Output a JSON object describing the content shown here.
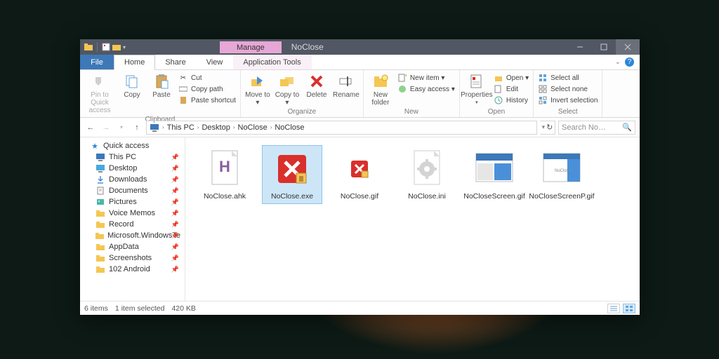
{
  "titlebar": {
    "manage": "Manage",
    "title": "NoClose"
  },
  "tabs": {
    "file": "File",
    "home": "Home",
    "share": "Share",
    "view": "View",
    "app_tools": "Application Tools"
  },
  "ribbon": {
    "clipboard": {
      "label": "Clipboard",
      "pin": "Pin to Quick access",
      "copy": "Copy",
      "paste": "Paste",
      "cut": "Cut",
      "copy_path": "Copy path",
      "paste_shortcut": "Paste shortcut"
    },
    "organize": {
      "label": "Organize",
      "move": "Move to ▾",
      "copy": "Copy to ▾",
      "delete": "Delete",
      "rename": "Rename"
    },
    "new": {
      "label": "New",
      "folder": "New folder",
      "item": "New item ▾",
      "easy": "Easy access ▾"
    },
    "open": {
      "label": "Open",
      "properties": "Properties",
      "open": "Open ▾",
      "edit": "Edit",
      "history": "History"
    },
    "select": {
      "label": "Select",
      "all": "Select all",
      "none": "Select none",
      "invert": "Invert selection"
    }
  },
  "breadcrumb": [
    "This PC",
    "Desktop",
    "NoClose",
    "NoClose"
  ],
  "search": {
    "placeholder": "Search No…"
  },
  "nav": {
    "quick": "Quick access",
    "items": [
      {
        "label": "This PC",
        "ico": "pc"
      },
      {
        "label": "Desktop",
        "ico": "desktop"
      },
      {
        "label": "Downloads",
        "ico": "dl"
      },
      {
        "label": "Documents",
        "ico": "doc"
      },
      {
        "label": "Pictures",
        "ico": "pic"
      },
      {
        "label": "Voice Memos",
        "ico": "folder"
      },
      {
        "label": "Record",
        "ico": "folder"
      },
      {
        "label": "Microsoft.WindowsTe",
        "ico": "folder"
      },
      {
        "label": "AppData",
        "ico": "folder"
      },
      {
        "label": "Screenshots",
        "ico": "folder"
      },
      {
        "label": "102 Android",
        "ico": "folder"
      }
    ]
  },
  "files": [
    {
      "name": "NoClose.ahk",
      "type": "ahk",
      "selected": false
    },
    {
      "name": "NoClose.exe",
      "type": "exe",
      "selected": true
    },
    {
      "name": "NoClose.gif",
      "type": "gif-small",
      "selected": false
    },
    {
      "name": "NoClose.ini",
      "type": "ini",
      "selected": false
    },
    {
      "name": "NoCloseScreen.gif",
      "type": "gif-thumb1",
      "selected": false
    },
    {
      "name": "NoCloseScreenP.gif",
      "type": "gif-thumb2",
      "selected": false
    }
  ],
  "status": {
    "count": "6 items",
    "selected": "1 item selected",
    "size": "420 KB"
  }
}
